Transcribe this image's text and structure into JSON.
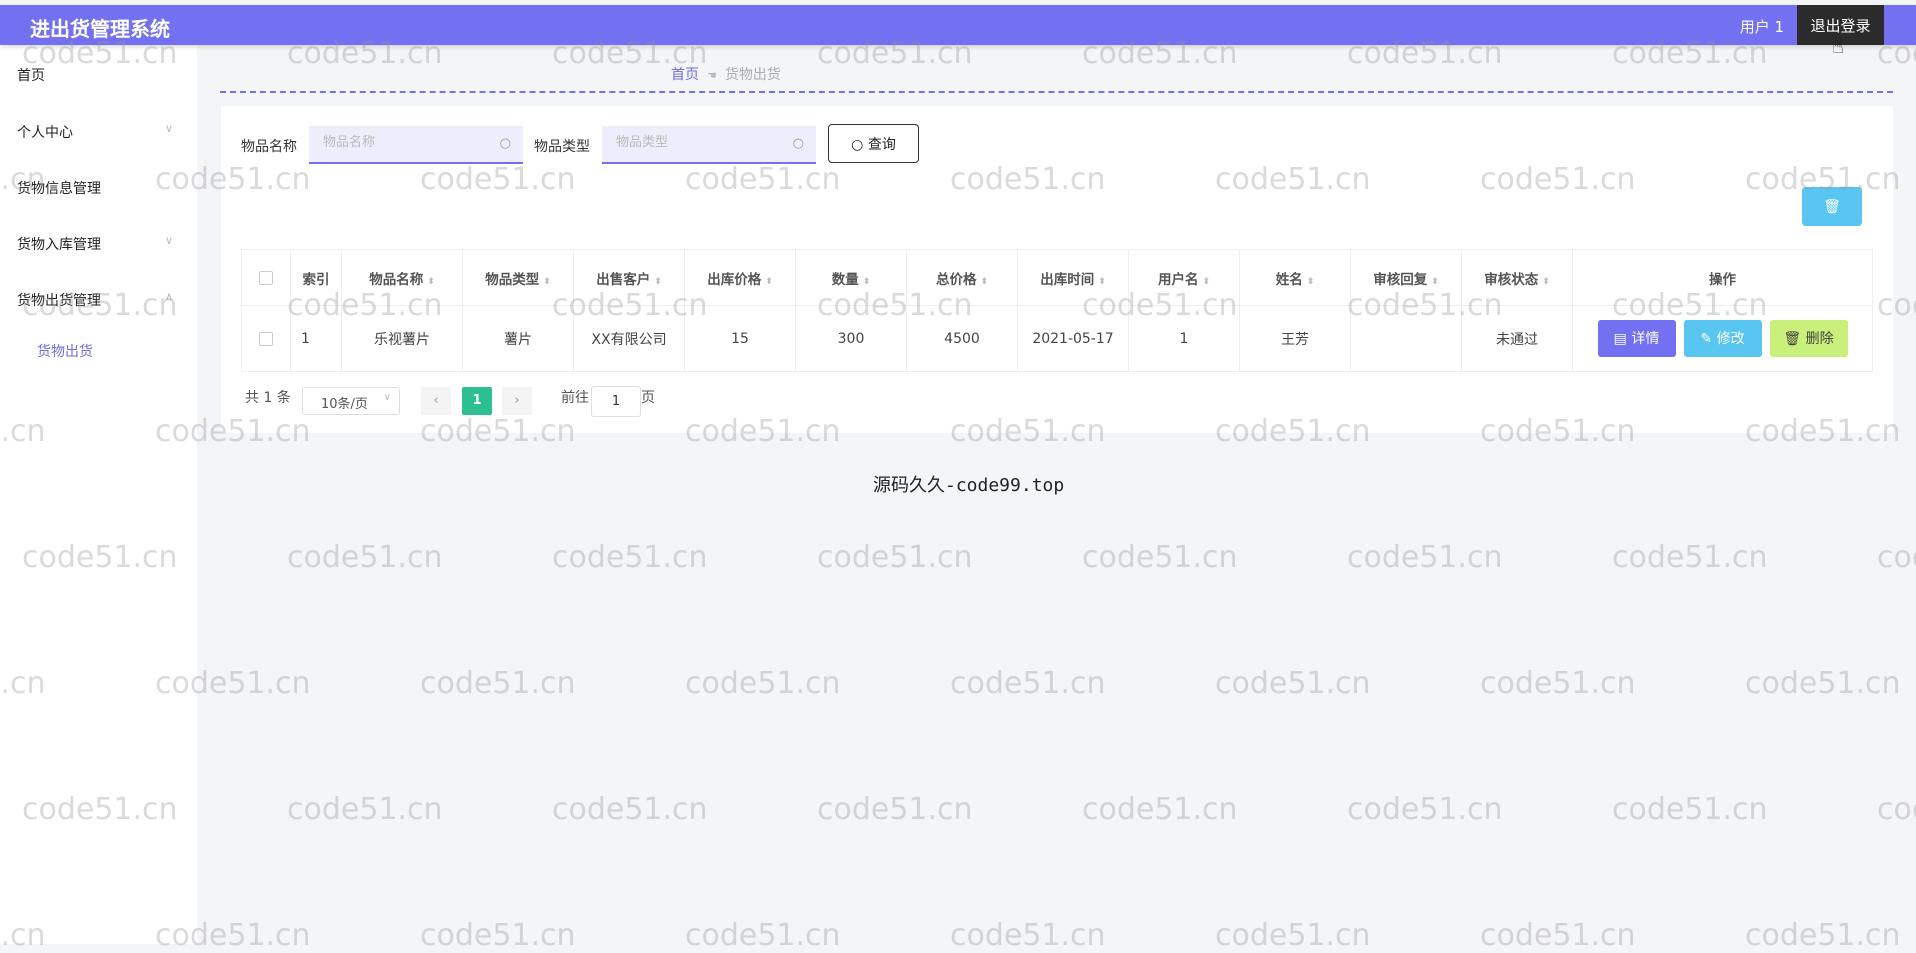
{
  "app": {
    "title": "进出货管理系统",
    "user": "用户 1",
    "logout": "退出登录"
  },
  "sidebar": {
    "items": [
      {
        "label": "首页"
      },
      {
        "label": "个人中心"
      },
      {
        "label": "货物信息管理"
      },
      {
        "label": "货物入库管理"
      },
      {
        "label": "货物出货管理"
      }
    ],
    "sub_item": "货物出货"
  },
  "breadcrumb": {
    "home": "首页",
    "current": "货物出货"
  },
  "search": {
    "name_label": "物品名称",
    "name_placeholder": "物品名称",
    "type_label": "物品类型",
    "type_placeholder": "物品类型",
    "query_label": "查询"
  },
  "table": {
    "headers": [
      "索引",
      "物品名称",
      "物品类型",
      "出售客户",
      "出库价格",
      "数量",
      "总价格",
      "出库时间",
      "用户名",
      "姓名",
      "审核回复",
      "审核状态",
      "操作"
    ],
    "rows": [
      {
        "index": "1",
        "name": "乐视薯片",
        "type": "薯片",
        "customer": "XX有限公司",
        "price": "15",
        "qty": "300",
        "total": "4500",
        "date": "2021-05-17",
        "username": "1",
        "fullname": "王芳",
        "reply": "",
        "status": "未通过"
      }
    ],
    "actions": {
      "detail": "详情",
      "edit": "修改",
      "delete": "删除"
    }
  },
  "pagination": {
    "total": "共 1 条",
    "page_size": "10条/页",
    "current": "1",
    "goto_prefix": "前往",
    "goto_value": "1",
    "goto_suffix": "页"
  },
  "footer": "源码久久-code99.top",
  "watermark": "code51.cn",
  "colors": {
    "accent": "#7371f2",
    "info": "#58c6f0",
    "success": "#2cbf8f",
    "warning": "#c8f07a"
  }
}
